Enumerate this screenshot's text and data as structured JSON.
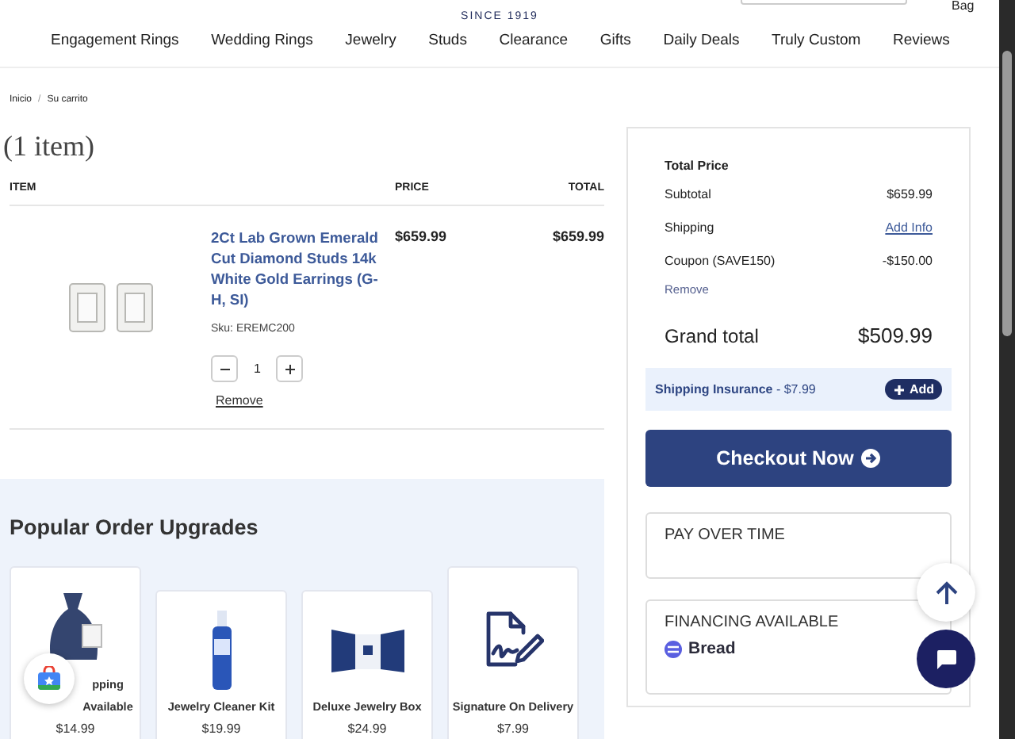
{
  "header": {
    "tagline": "SINCE 1919",
    "bag_label": "Bag",
    "nav": [
      "Engagement Rings",
      "Wedding Rings",
      "Jewelry",
      "Studs",
      "Clearance",
      "Gifts",
      "Daily Deals",
      "Truly Custom",
      "Reviews"
    ]
  },
  "breadcrumb": {
    "separator": "/",
    "items": [
      "Inicio",
      "Su carrito"
    ]
  },
  "cart": {
    "count": "(1 item)",
    "columns": [
      "ITEM",
      "PRICE",
      "TOTAL"
    ],
    "items": [
      {
        "name": "2Ct Lab Grown Emerald Cut Diamond Studs 14k White Gold Earrings (G-H, SI)",
        "sku": "Sku: EREMC200",
        "price": "$659.99",
        "total": "$659.99",
        "quantity": "1",
        "remove": "Remove"
      }
    ]
  },
  "upgrades": {
    "title": "Popular Order Upgrades",
    "items": [
      {
        "kind": "pouch",
        "name": "pping Available",
        "price": "$14.99"
      },
      {
        "kind": "bottle",
        "name": "Jewelry Cleaner Kit",
        "price": "$19.99"
      },
      {
        "kind": "box",
        "name": "Deluxe Jewelry Box",
        "price": "$24.99"
      },
      {
        "kind": "signature",
        "name": "Signature On Delivery",
        "price": "$7.99"
      }
    ]
  },
  "summary": {
    "title": "Total Price",
    "lines": [
      {
        "kind": "amount",
        "label": "Subtotal",
        "value": "$659.99"
      },
      {
        "kind": "link",
        "label": "Shipping",
        "value": "Add Info"
      },
      {
        "kind": "coupon",
        "label": "Coupon (SAVE150)",
        "value": "-$150.00",
        "action": "Remove"
      }
    ],
    "grand_label": "Grand total",
    "grand_value": "$509.99",
    "insurance": {
      "label": "Shipping Insurance",
      "price": "- $7.99",
      "button": "Add"
    },
    "checkout": "Checkout Now",
    "pay_over_time": "PAY OVER TIME",
    "financing": {
      "title": "FINANCING AVAILABLE",
      "provider": "Bread"
    }
  }
}
